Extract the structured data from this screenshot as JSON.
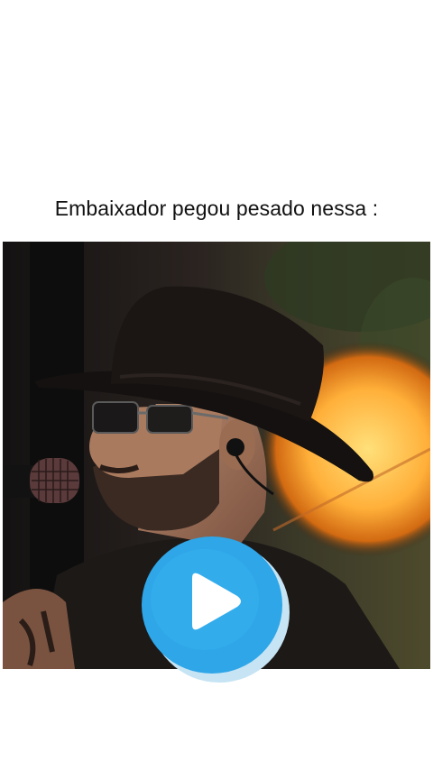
{
  "post": {
    "caption": "Embaixador pegou pesado nessa :"
  },
  "video": {
    "play_icon": "play-icon",
    "accent_color": "#2ea6e8"
  }
}
